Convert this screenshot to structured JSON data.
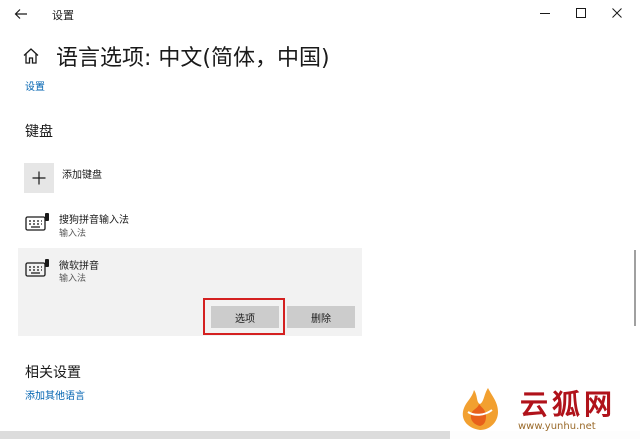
{
  "window": {
    "title": "设置",
    "controls": [
      "minimize-icon",
      "maximize-icon",
      "close-icon"
    ]
  },
  "header": {
    "page_title": "语言选项: 中文(简体，中国)",
    "breadcrumb": "设置"
  },
  "keyboard_section": {
    "title": "键盘",
    "add_label": "添加键盘",
    "items": [
      {
        "name": "搜狗拼音输入法",
        "type": "输入法",
        "icon": "keyboard-icon"
      },
      {
        "name": "微软拼音",
        "type": "输入法",
        "icon": "keyboard-icon",
        "selected": true
      }
    ],
    "options_label": "选项",
    "delete_label": "删除"
  },
  "related_section": {
    "title": "相关设置",
    "link": "添加其他语言"
  },
  "watermark": {
    "brand": "云狐网",
    "url": "www.yunhu.net"
  },
  "colors": {
    "link": "#0063b1",
    "highlight": "#d42020",
    "button": "#cccccc",
    "selected_bg": "#f2f2f2",
    "brand_red": "#b0121a"
  }
}
